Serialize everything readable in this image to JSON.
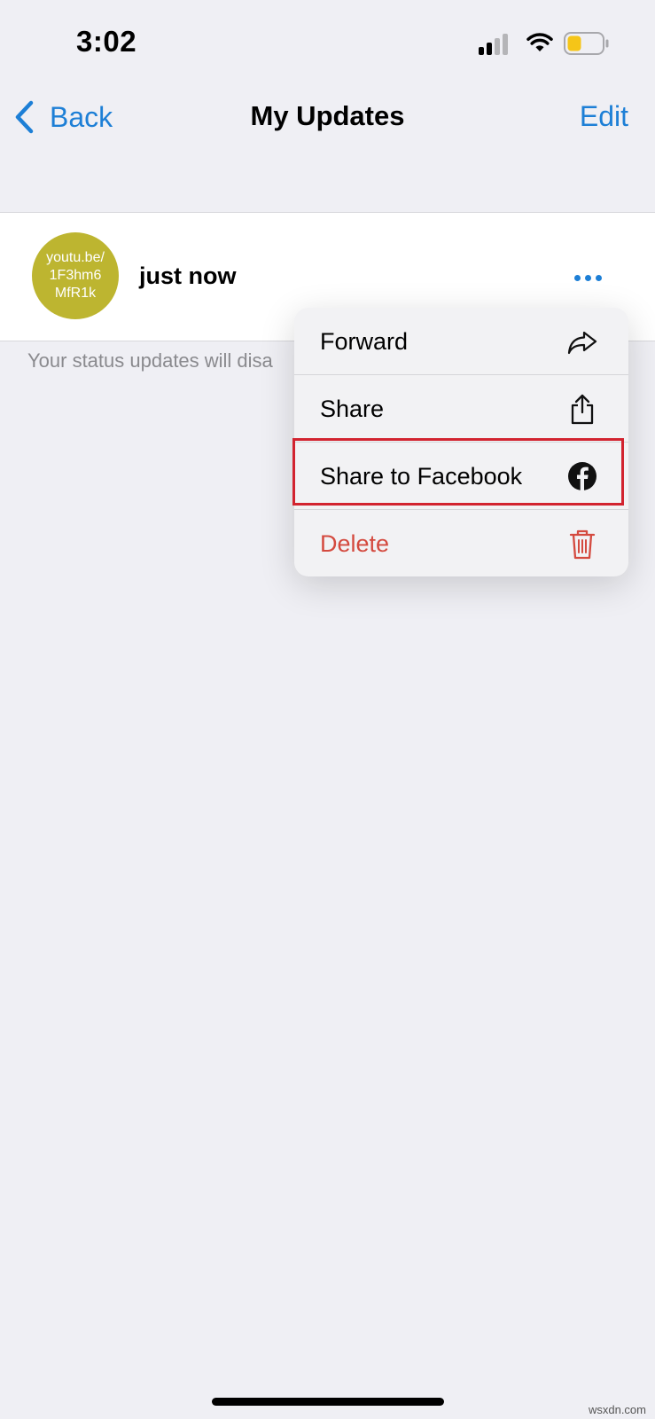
{
  "status_bar": {
    "time": "3:02",
    "signal_icon": "cellular-signal-icon",
    "wifi_icon": "wifi-icon",
    "battery_icon": "battery-low-icon",
    "battery_color": "#f5c518"
  },
  "nav": {
    "back_label": "Back",
    "title": "My Updates",
    "edit_label": "Edit",
    "accent_color": "#1d7fd6"
  },
  "update": {
    "thumbnail_lines": [
      "youtu.be/",
      "1F3hm6",
      "MfR1k"
    ],
    "thumbnail_color": "#bdb530",
    "time": "just now"
  },
  "footnote": "Your status updates will disa",
  "context_menu": {
    "items": [
      {
        "label": "Forward",
        "icon": "forward-arrow-icon"
      },
      {
        "label": "Share",
        "icon": "share-icon"
      },
      {
        "label": "Share to Facebook",
        "icon": "facebook-icon",
        "highlighted": true
      },
      {
        "label": "Delete",
        "icon": "trash-icon",
        "destructive": true
      }
    ],
    "highlight_color": "#d2232f",
    "destructive_color": "#d44a3f"
  },
  "watermark": "wsxdn.com"
}
